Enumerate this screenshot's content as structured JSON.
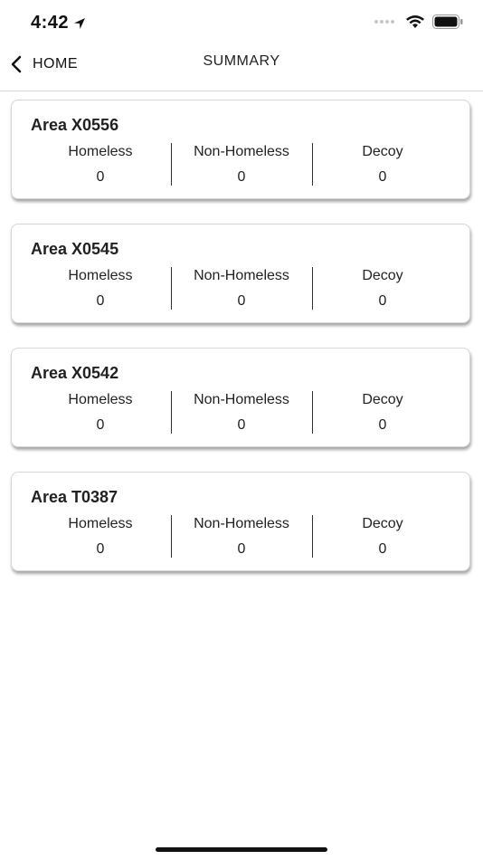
{
  "status_bar": {
    "time": "4:42",
    "icons": [
      "location-arrow-icon",
      "cellular-signal-icon",
      "wifi-icon",
      "battery-icon"
    ]
  },
  "nav": {
    "back_label": "HOME",
    "title": "SUMMARY"
  },
  "areas": [
    {
      "name": "Area X0556",
      "stats": [
        {
          "label": "Homeless",
          "value": "0"
        },
        {
          "label": "Non-Homeless",
          "value": "0"
        },
        {
          "label": "Decoy",
          "value": "0"
        }
      ]
    },
    {
      "name": "Area X0545",
      "stats": [
        {
          "label": "Homeless",
          "value": "0"
        },
        {
          "label": "Non-Homeless",
          "value": "0"
        },
        {
          "label": "Decoy",
          "value": "0"
        }
      ]
    },
    {
      "name": "Area X0542",
      "stats": [
        {
          "label": "Homeless",
          "value": "0"
        },
        {
          "label": "Non-Homeless",
          "value": "0"
        },
        {
          "label": "Decoy",
          "value": "0"
        }
      ]
    },
    {
      "name": "Area T0387",
      "stats": [
        {
          "label": "Homeless",
          "value": "0"
        },
        {
          "label": "Non-Homeless",
          "value": "0"
        },
        {
          "label": "Decoy",
          "value": "0"
        }
      ]
    }
  ]
}
